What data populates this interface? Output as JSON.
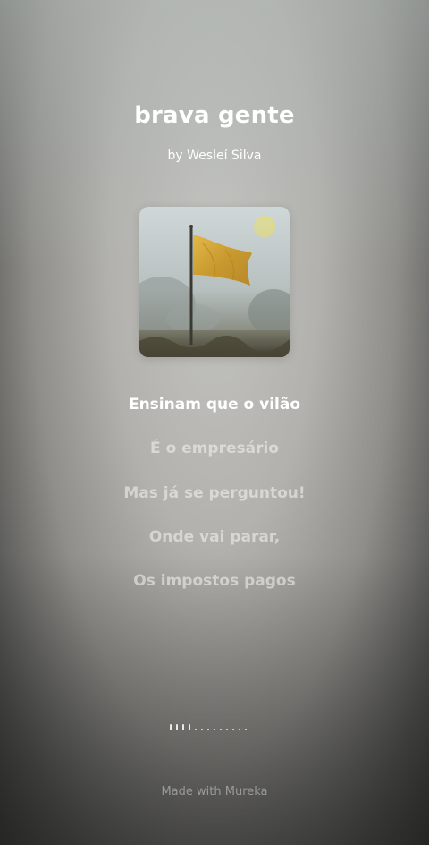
{
  "song": {
    "title": "brava gente",
    "artist": "by Wesleí Silva"
  },
  "cover": {
    "icon": "waving-flag-in-fog-icon",
    "flag_color": "#d2a53a"
  },
  "lyrics": {
    "lines": [
      "Ensinam que o vilão",
      "É o empresário",
      "Mas já se perguntou!",
      "Onde vai parar,",
      "Os impostos pagos"
    ],
    "active_index": 0
  },
  "progress": {
    "ticks": 13,
    "played_fraction": 0.3
  },
  "footer": {
    "text": "Made with Mureka"
  },
  "colors": {
    "text": "#ffffff",
    "inactive_lyric": "#d9d9d6"
  }
}
